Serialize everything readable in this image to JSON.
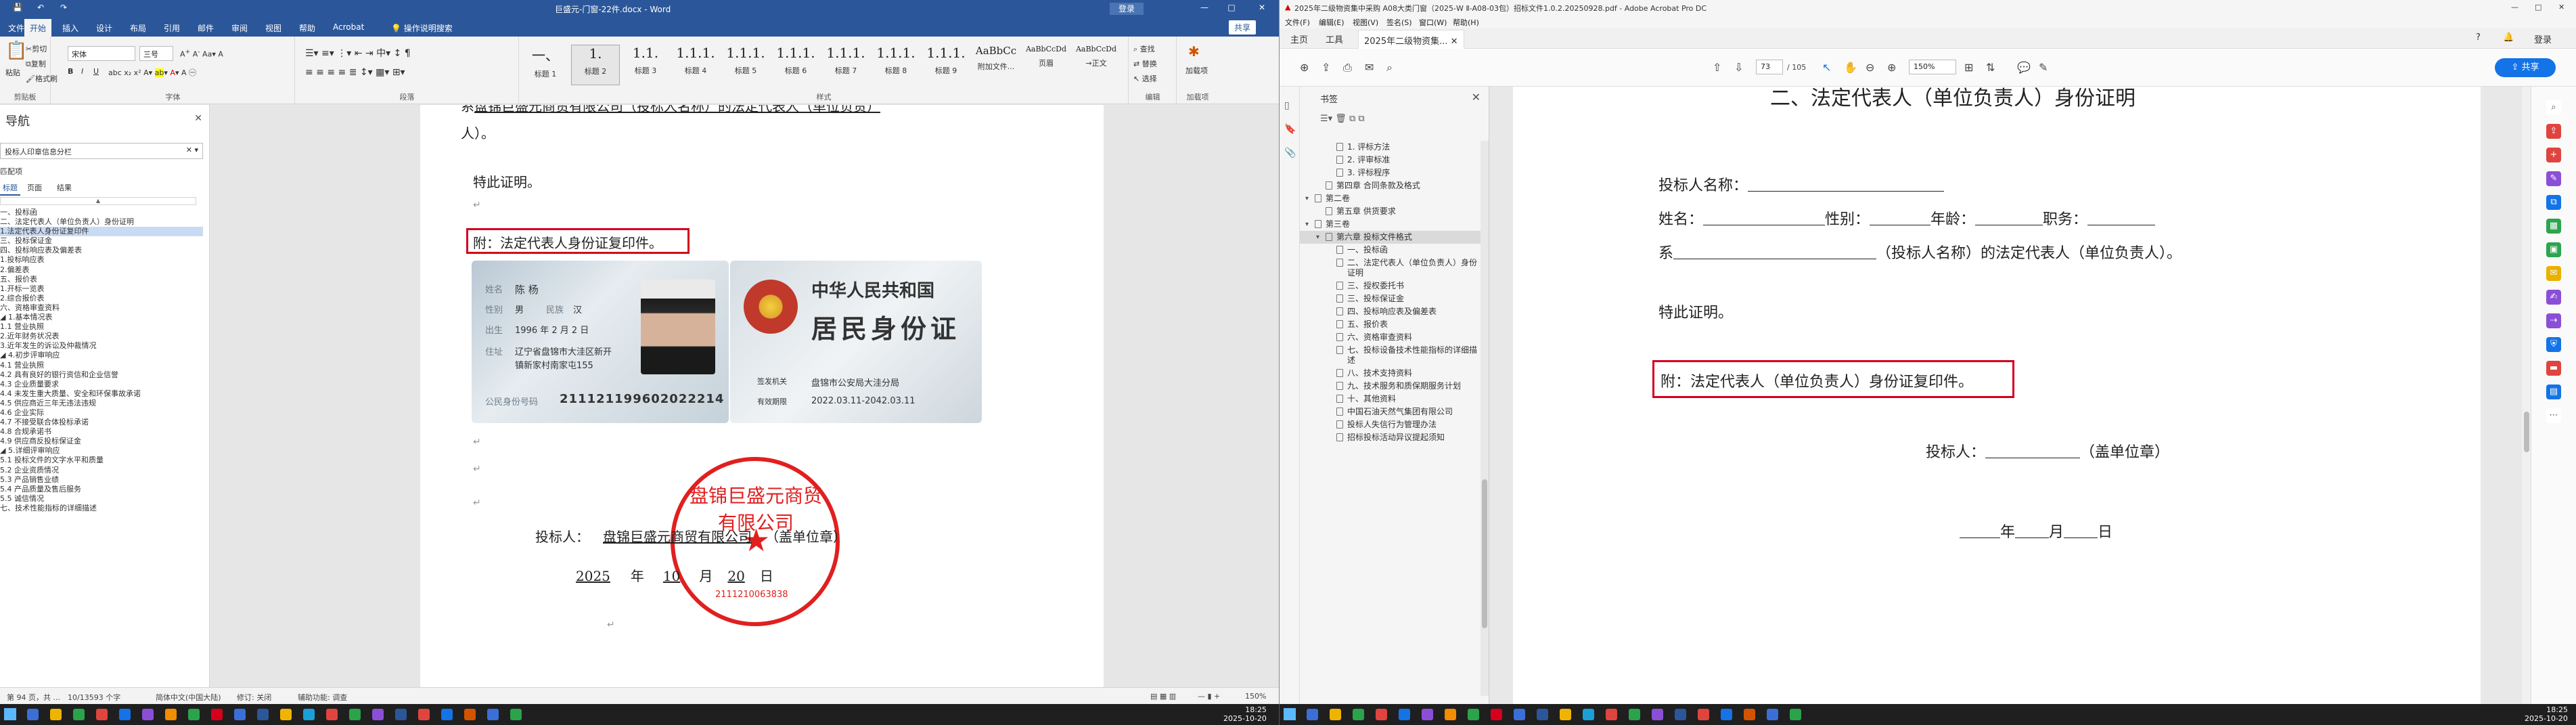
{
  "word": {
    "title": "巨盛元-门窗-22件.docx - Word",
    "title_right": [
      "登录",
      "—",
      "□",
      "✕"
    ],
    "share": "共享",
    "tabs": [
      "文件",
      "开始",
      "插入",
      "设计",
      "布局",
      "引用",
      "邮件",
      "审阅",
      "视图",
      "帮助",
      "Acrobat",
      "操作说明搜索"
    ],
    "active_tab": "开始",
    "clipboard": {
      "cut": "剪切",
      "copy": "复制",
      "painter": "格式刷",
      "paste": "粘贴",
      "label": "剪贴板"
    },
    "font": {
      "name": "宋体",
      "size": "三号",
      "label": "字体"
    },
    "paragraph_label": "段落",
    "styles": [
      {
        "sample": "一、",
        "name": "标题 1"
      },
      {
        "sample": "1.",
        "name": "标题 2"
      },
      {
        "sample": "1.1.",
        "name": "标题 3"
      },
      {
        "sample": "1.1.1.",
        "name": "标题 4"
      },
      {
        "sample": "1.1.1.",
        "name": "标题 5"
      },
      {
        "sample": "1.1.1.",
        "name": "标题 6"
      },
      {
        "sample": "1.1.1.",
        "name": "标题 7"
      },
      {
        "sample": "1.1.1.",
        "name": "标题 8"
      },
      {
        "sample": "1.1.1.",
        "name": "标题 9"
      },
      {
        "sample": "AaBbCc",
        "name": "附加文件..."
      },
      {
        "sample": "AaBbCcDd",
        "name": "页眉"
      },
      {
        "sample": "AaBbCcDd",
        "name": "→正文"
      }
    ],
    "styles_label": "样式",
    "editing": {
      "find": "查找",
      "replace": "替换",
      "select": "选择",
      "label": "编辑"
    },
    "addin": {
      "name": "加载项",
      "label": "加载项"
    },
    "nav": {
      "title": "导航",
      "search_value": "投标人印章信息分栏",
      "matches": "匹配项",
      "tabs": [
        "标题",
        "页面",
        "结果"
      ],
      "items": [
        "一、投标函",
        "二、法定代表人（单位负责人）身份证明",
        "  1.法定代表人身份证复印件",
        "三、投标保证金",
        "四、投标响应表及偏差表",
        "  1.投标响应表",
        "  2.偏差表",
        "五、报价表",
        "  1.开标一览表",
        "  2.综合报价表",
        "六、资格审查资料",
        "◢ 1.基本情况表",
        "    1.1 营业执照",
        "  2.近年财务状况表",
        "  3.近年发生的诉讼及仲裁情况",
        "◢ 4.初步评审响应",
        "    4.1 营业执照",
        "    4.2 具有良好的银行资信和企业信誉",
        "    4.3 企业质量要求",
        "    4.4 未发生重大质量、安全和环保事故承诺",
        "    4.5 供应商近三年无违法违规",
        "    4.6 企业实际",
        "    4.7 不接受联合体投标承诺",
        "    4.8 合规承诺书",
        "    4.9 供应商反投标保证金",
        "◢ 5.详细评审响应",
        "    5.1 投标文件的文字水平和质量",
        "    5.2 企业资质情况",
        "    5.3 产品销售业绩",
        "    5.4 产品质量及售后服务",
        "    5.5 诚信情况",
        "七、技术性能指标的详细描述"
      ],
      "selected_index": 2
    },
    "doc": {
      "line_top": "系",
      "line_top_rest": "盘锦巨盛元商贸有限公司（投标人名称）的法定代表人（单位负责）",
      "line_top2": "人）。",
      "proof": "特此证明。",
      "attach": "附：法定代表人身份证复印件。",
      "bidder_label": "投标人：",
      "bidder_name": "盘锦巨盛元商贸有限公司",
      "bidder_seal": "（盖单位章）",
      "date_year": "2025",
      "date_month": "10",
      "date_day": "20",
      "date_y_label": "年",
      "date_m_label": "月",
      "date_d_label": "日"
    },
    "idcard": {
      "name_label": "姓名",
      "name": "陈 杨",
      "sex_label": "性别",
      "sex": "男",
      "ethnic_label": "民族",
      "ethnic": "汉",
      "birth_label": "出生",
      "birth": "1996 年 2 月 2 日",
      "addr_label": "住址",
      "addr1": "辽宁省盘锦市大洼区新开",
      "addr2": "镇新家村南家屯155",
      "id_label": "公民身份号码",
      "id_no": "211121199602022214",
      "country": "中华人民共和国",
      "card_title": "居民身份证",
      "issuer_label": "签发机关",
      "issuer": "盘锦市公安局大洼分局",
      "valid_label": "有效期限",
      "valid": "2022.03.11-2042.03.11"
    },
    "seal": {
      "text": "盘锦巨盛元商贸有限公司",
      "code": "2111210063838"
    },
    "status": {
      "page": "第 94 页，共 ...",
      "words": "10/13593 个字",
      "lang": "简体中文(中国大陆)",
      "track": "修订: 关闭",
      "access": "辅助功能: 调查",
      "zoom": "150%"
    }
  },
  "acrobat": {
    "title": "2025年二级物资集中采购 A08大类门窗（2025-W Ⅱ-A08-03包）招标文件1.0.2.20250928.pdf - Adobe Acrobat Pro DC",
    "menus": [
      "文件(F)",
      "编辑(E)",
      "视图(V)",
      "签名(S)",
      "窗口(W)",
      "帮助(H)"
    ],
    "tabs": [
      "主页",
      "工具",
      "2025年二级物资集..."
    ],
    "page_current": "73",
    "page_total": "/ 105",
    "zoom": "150%",
    "share": "共享",
    "bookmarks_title": "书签",
    "bookmarks": [
      {
        "level": 2,
        "text": "1. 评标方法"
      },
      {
        "level": 2,
        "text": "2. 评审标准"
      },
      {
        "level": 2,
        "text": "3. 评标程序"
      },
      {
        "level": 1,
        "text": "第四章  合同条款及格式"
      },
      {
        "level": 0,
        "text": "第二卷",
        "arrow": true
      },
      {
        "level": 1,
        "text": "第五章  供货要求"
      },
      {
        "level": 0,
        "text": "第三卷",
        "arrow": true
      },
      {
        "level": 1,
        "text": "第六章  投标文件格式",
        "arrow": true,
        "sel": true
      },
      {
        "level": 2,
        "text": "一、投标函"
      },
      {
        "level": 2,
        "text": "二、法定代表人（单位负责人）身份证明"
      },
      {
        "level": 2,
        "text": "三、授权委托书"
      },
      {
        "level": 2,
        "text": "三、投标保证金"
      },
      {
        "level": 2,
        "text": "四、投标响应表及偏差表"
      },
      {
        "level": 2,
        "text": "五、报价表"
      },
      {
        "level": 2,
        "text": "六、资格审查资料"
      },
      {
        "level": 2,
        "text": "七、投标设备技术性能指标的详细描述"
      },
      {
        "level": 2,
        "text": "八、技术支持资料"
      },
      {
        "level": 2,
        "text": "九、技术服务和质保期服务计划"
      },
      {
        "level": 2,
        "text": "十、其他资料"
      },
      {
        "level": 2,
        "text": "中国石油天然气集团有限公司"
      },
      {
        "level": 2,
        "text": "投标人失信行为管理办法"
      },
      {
        "level": 2,
        "text": "招标投标活动异议提起须知"
      }
    ],
    "page": {
      "title": "二、法定代表人（单位负责人）身份证明",
      "l1": "投标人名称：",
      "l2a": "姓名：",
      "l2b": "性别：",
      "l2c": "年龄：",
      "l2d": "职务：",
      "l3a": "系",
      "l3b": "（投标人名称）的法定代表人（单位负责人）。",
      "proof": "特此证明。",
      "attach": "附：法定代表人（单位负责人）身份证复印件。",
      "bidder": "投标人：",
      "seal": "（盖单位章）",
      "year": "年",
      "month": "月",
      "day": "日"
    }
  },
  "taskbar": {
    "left_time": "18:25",
    "left_date": "2025-10-20",
    "right_time": "18:25",
    "right_date": "2025-10-20"
  },
  "colors": {
    "word_blue": "#2b579a",
    "highlight_red": "#d6001c",
    "seal_red": "#e0201f",
    "acrobat_blue": "#1473e6"
  }
}
